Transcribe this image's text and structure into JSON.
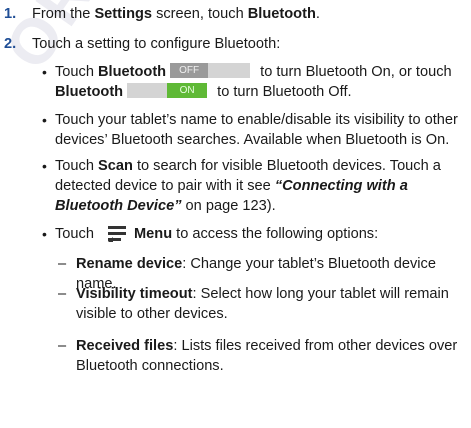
{
  "watermark": "ORIGINAL",
  "steps": [
    {
      "num": "1.",
      "pre": "From the ",
      "bold1": "Settings",
      "mid": " screen, touch ",
      "bold2": "Bluetooth",
      "post": "."
    },
    {
      "num": "2.",
      "text": "Touch a setting to configure Bluetooth:"
    }
  ],
  "bullets": {
    "toggle": {
      "pre": "Touch ",
      "bold_a": "Bluetooth",
      "off_label": "OFF",
      "mid": " to turn Bluetooth On, or touch",
      "bold_b": "Bluetooth",
      "on_label": "ON",
      "post": " to turn Bluetooth Off."
    },
    "visibility": {
      "line1": "Touch your tablet’s name to enable/disable its visibility to other",
      "line2": "devices’ Bluetooth searches. Available when Bluetooth is On."
    },
    "scan": {
      "pre": "Touch ",
      "bold": "Scan",
      "line1_post": " to search for visible Bluetooth devices. Touch a",
      "line2_pre": "detected device to pair with it see ",
      "ref_a": "“Connecting with a",
      "ref_b": "Bluetooth Device”",
      "line3_post": " on page 123)."
    },
    "menu": {
      "pre": "Touch ",
      "icon": "menu-icon",
      "bold": "Menu",
      "post": " to access the following options:"
    }
  },
  "options": [
    {
      "dash": "–",
      "name": "Rename device",
      "line1": ": Change your tablet’s Bluetooth device name.",
      "line2": ""
    },
    {
      "dash": "–",
      "name": "Visibility timeout",
      "line1": ": Select how long your tablet will remain",
      "line2": "visible to other devices."
    },
    {
      "dash": "–",
      "name": "Received files",
      "line1": ": Lists files received from other devices over",
      "line2": "Bluetooth connections."
    }
  ],
  "colors": {
    "step_number": "#1f4e96",
    "toggle_on": "#5fb936",
    "toggle_off": "#9a9a9a",
    "watermark": "#ececf2"
  }
}
